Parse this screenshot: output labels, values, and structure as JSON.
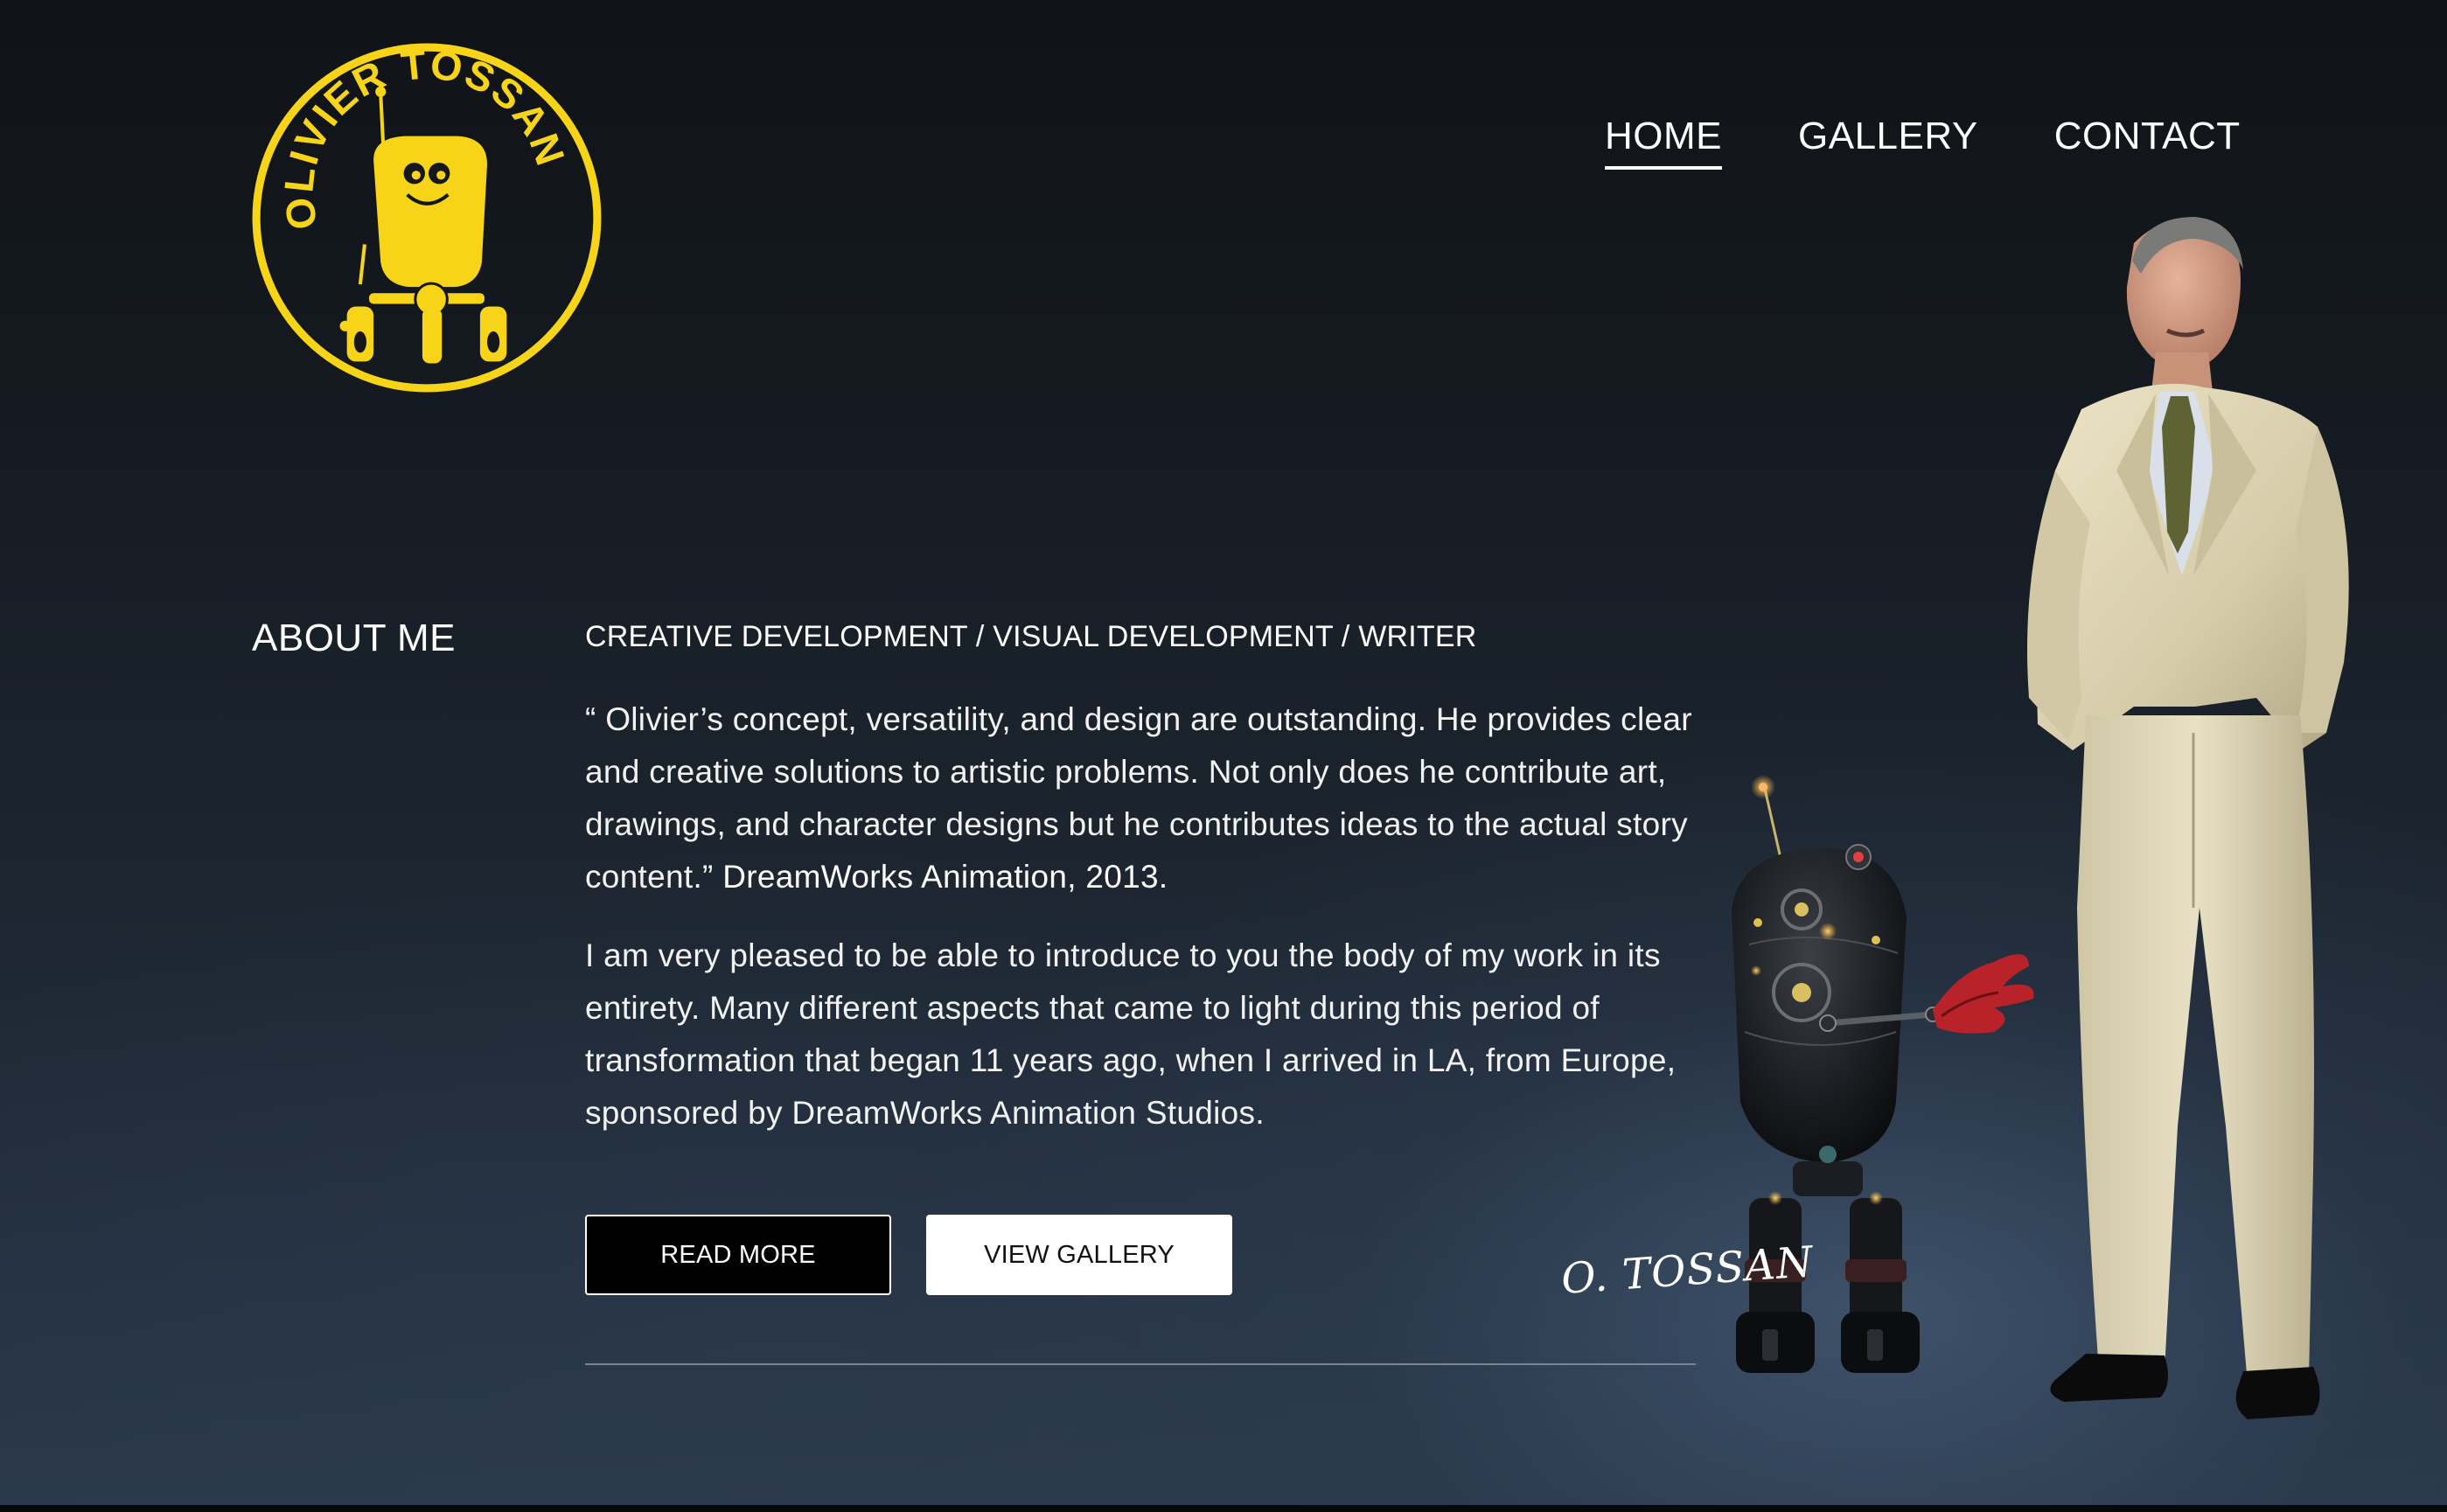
{
  "logo": {
    "text": "OLIVIER TOSSAN",
    "color": "#f7d417"
  },
  "nav": {
    "items": [
      {
        "label": "HOME",
        "active": true
      },
      {
        "label": "GALLERY",
        "active": false
      },
      {
        "label": "CONTACT",
        "active": false
      }
    ]
  },
  "about": {
    "heading": "ABOUT ME",
    "subtitle": "CREATIVE DEVELOPMENT / VISUAL DEVELOPMENT / WRITER",
    "quote": "“ Olivier’s concept, versatility, and design are outstanding. He provides clear and creative solutions to artistic problems. Not only does he contribute art, drawings, and character designs but he contributes ideas to the actual story content.”",
    "quote_credit": "DreamWorks Animation, 2013.",
    "intro": "I am very pleased to be able to introduce to you the body of my work in its entirety. Many different aspects that came to light during this period of transformation that began 11 years ago, when I arrived in LA, from Europe, sponsored by DreamWorks Animation Studios."
  },
  "buttons": {
    "read_more": "READ MORE",
    "view_gallery": "VIEW GALLERY"
  },
  "art": {
    "signature": "O. TOSSAN",
    "robot_icon": "robot-illustration",
    "portrait_icon": "man-in-suit-photo"
  }
}
